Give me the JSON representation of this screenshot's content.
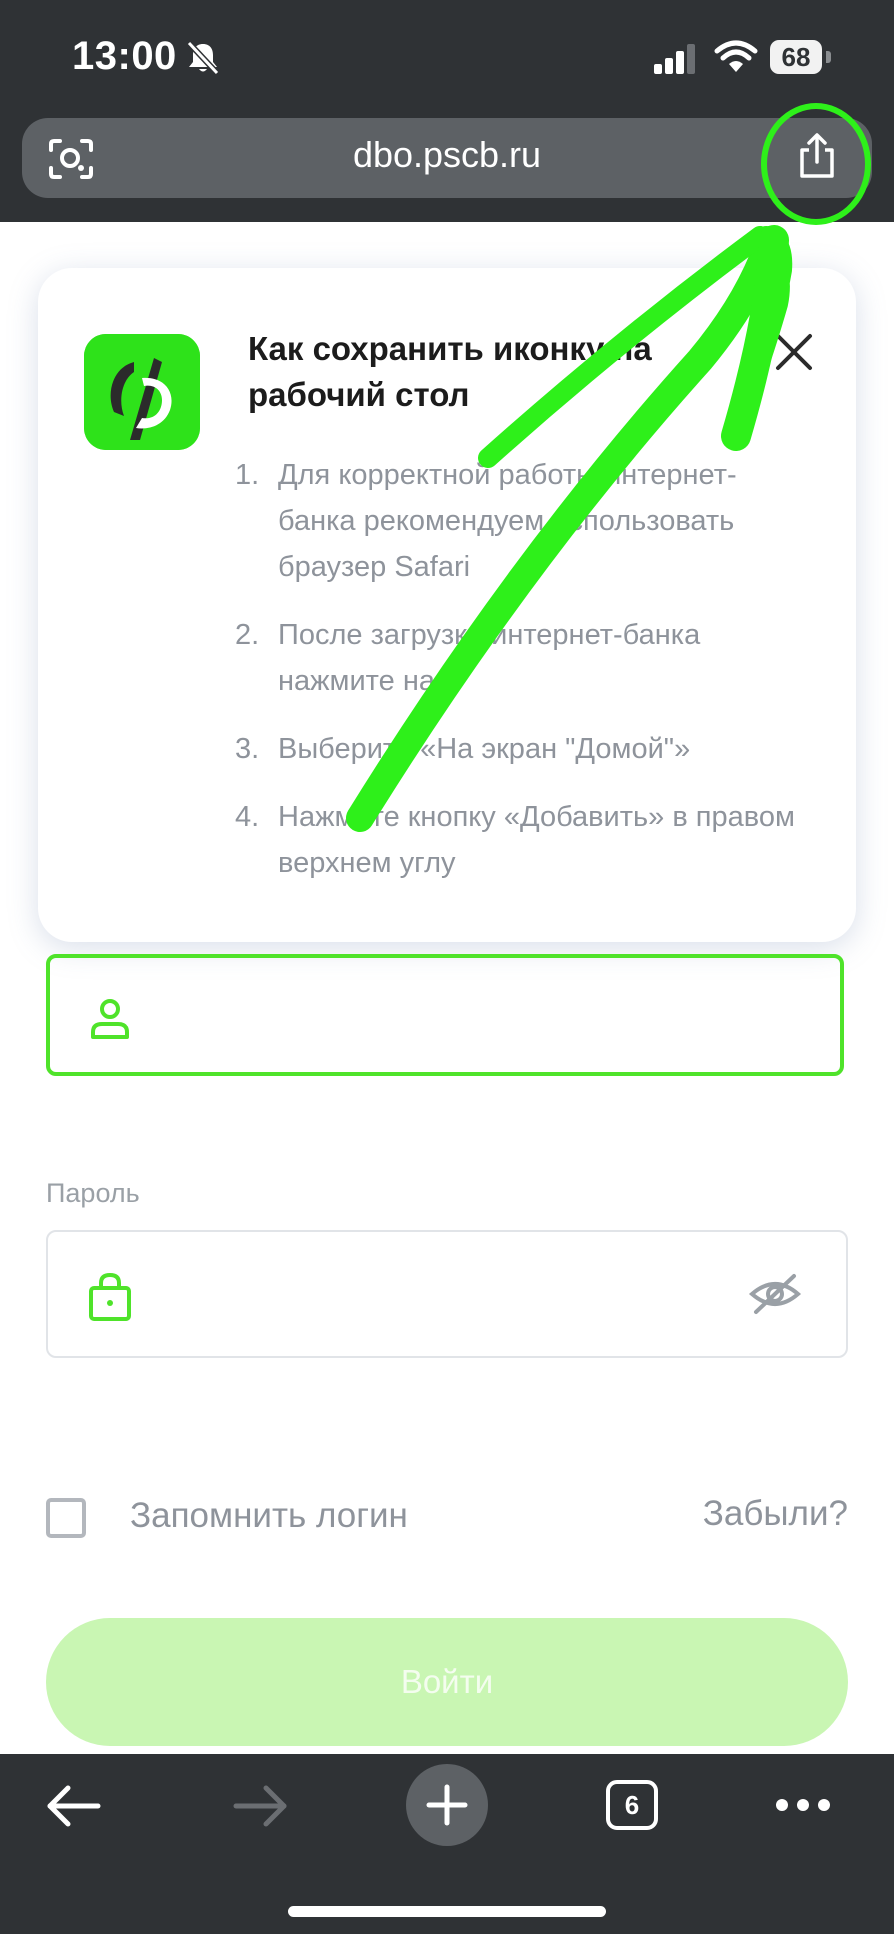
{
  "status_bar": {
    "time": "13:00",
    "battery": "68"
  },
  "browser": {
    "url": "dbo.pscb.ru",
    "tab_count": "6"
  },
  "popup": {
    "title": "Как сохранить иконку на рабочий стол",
    "steps": [
      {
        "num": "1.",
        "text": "Для корректной работы интернет-банка рекомендуем использовать браузер Safari"
      },
      {
        "num": "2.",
        "text": "После загрузки интернет-банка нажмите на"
      },
      {
        "num": "3.",
        "text": "Выберите «На экран \"Домой\"»"
      },
      {
        "num": "4.",
        "text": "Нажмите кнопку «Добавить» в правом верхнем углу"
      }
    ]
  },
  "form": {
    "password_label": "Пароль",
    "remember_label": "Запомнить логин",
    "forgot_label": "Забыли?",
    "submit_label": "Войти"
  },
  "icons": {
    "status": [
      "bell-off-icon",
      "signal-icon",
      "wifi-icon"
    ],
    "address_bar": [
      "lens-icon",
      "share-icon"
    ],
    "form": [
      "user-icon",
      "lock-icon",
      "eye-off-icon"
    ],
    "toolbar": [
      "back-icon",
      "forward-icon",
      "plus-icon",
      "more-icon"
    ]
  },
  "colors": {
    "chrome": "#2f3235",
    "accent_green": "#4fe32a",
    "annotation_green": "#2ef01a",
    "button_disabled": "#c9f6b3",
    "muted_text": "#8e939b"
  }
}
